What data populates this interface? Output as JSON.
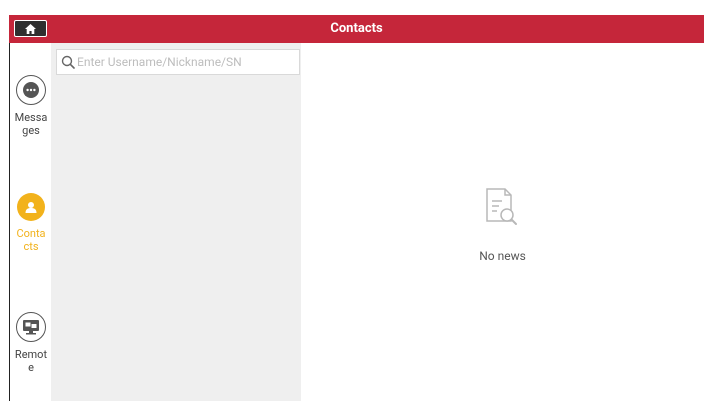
{
  "header": {
    "title": "Contacts",
    "home_icon": "home-icon"
  },
  "nav": {
    "items": [
      {
        "label": "Messa ges",
        "icon": "chat-bubble-icon",
        "active": false
      },
      {
        "label": "Conta cts",
        "icon": "person-icon",
        "active": true
      },
      {
        "label": "Remot e",
        "icon": "remote-desktop-icon",
        "active": false
      }
    ]
  },
  "search": {
    "placeholder": "Enter Username/Nickname/SN",
    "value": ""
  },
  "empty_state": {
    "text": "No news",
    "icon": "document-search-icon"
  },
  "colors": {
    "header_bg": "#c5263a",
    "active": "#f2b21b",
    "list_bg": "#efefef"
  }
}
